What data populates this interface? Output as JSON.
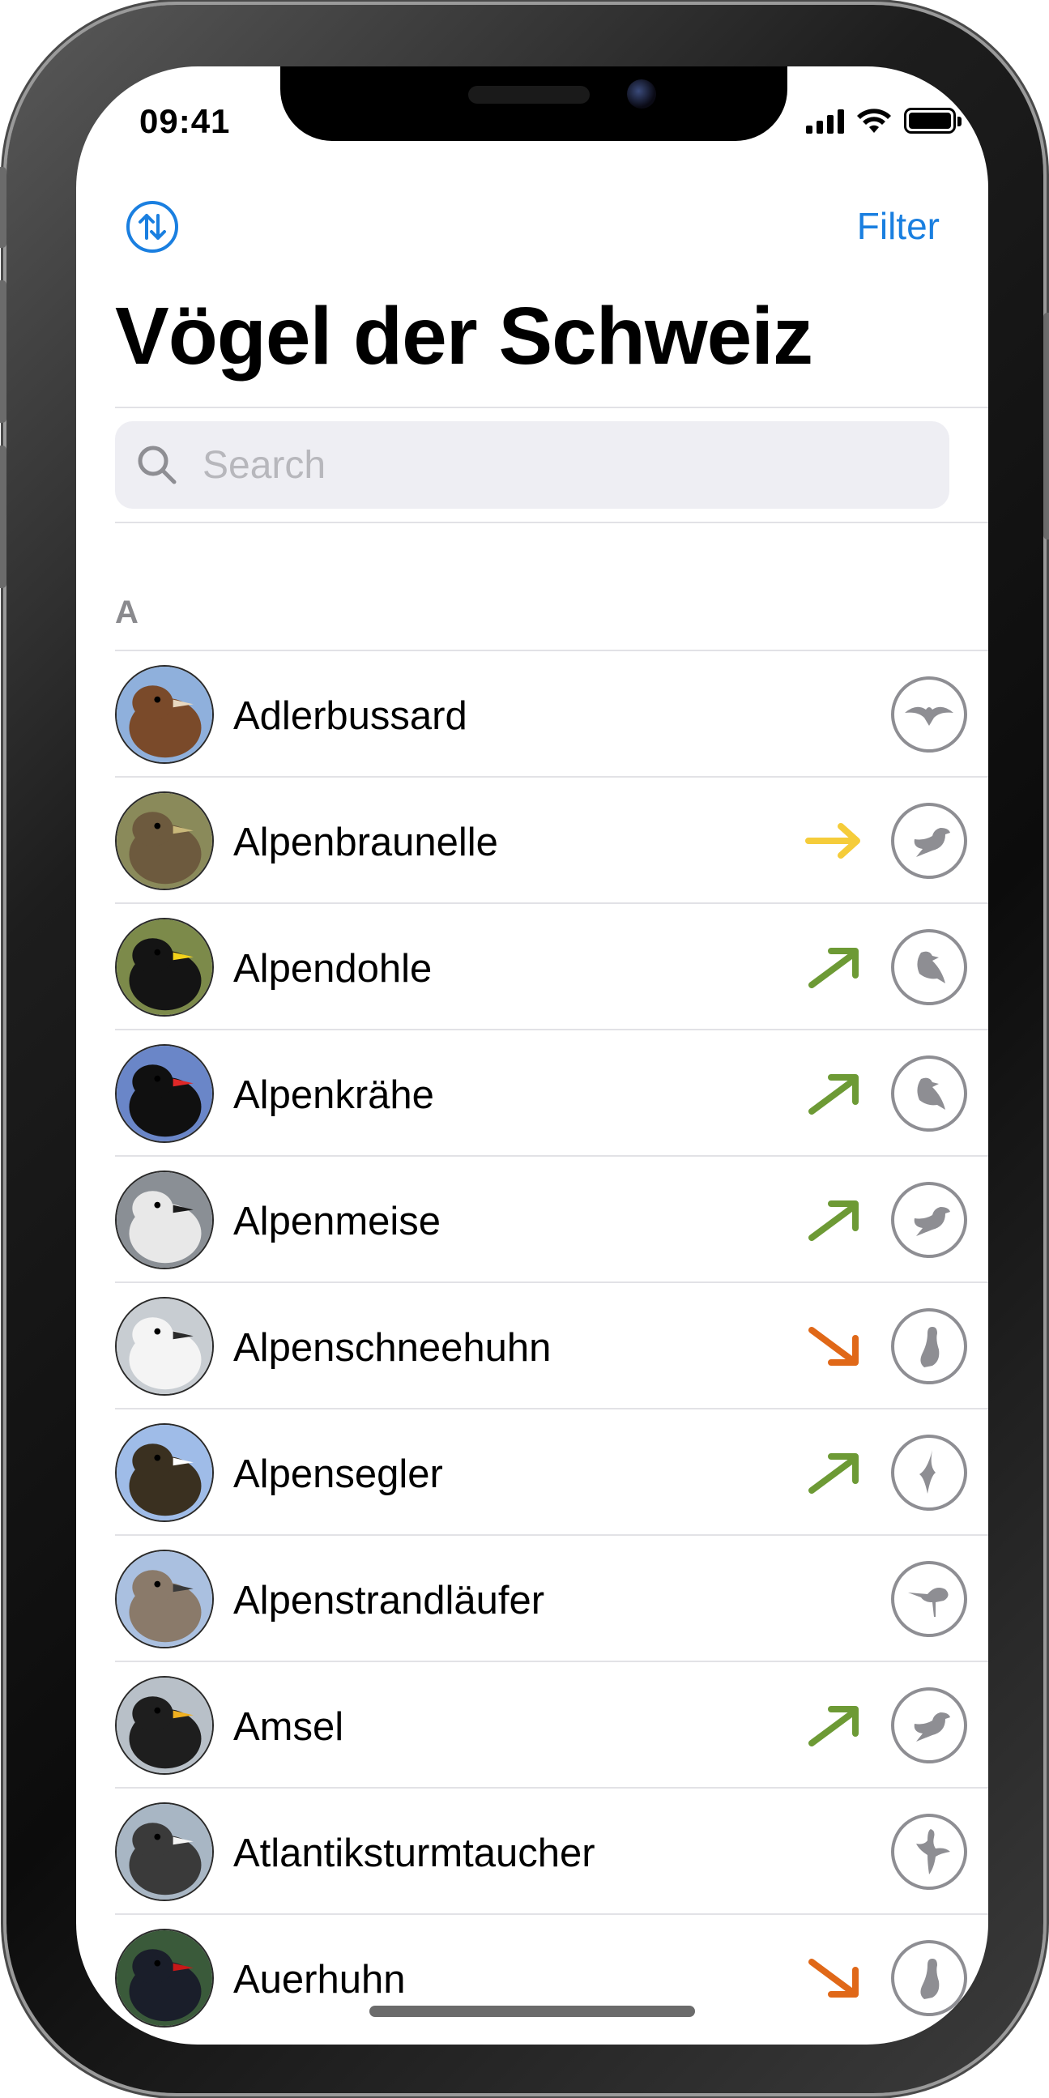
{
  "status_bar": {
    "time": "09:41"
  },
  "nav": {
    "title": "Vögel der Schweiz",
    "filter_label": "Filter",
    "sort_icon": "sort-arrows-icon"
  },
  "search": {
    "placeholder": "Search",
    "value": ""
  },
  "section": {
    "letter": "A"
  },
  "colors": {
    "accent": "#1a7fe0",
    "trend_flat": "#f5cc3a",
    "trend_up": "#6d9a35",
    "trend_down": "#e06818",
    "icon_gray": "#8e8e93"
  },
  "birds": [
    {
      "name": "Adlerbussard",
      "trend": "none",
      "type_icon": "raptor-icon"
    },
    {
      "name": "Alpenbraunelle",
      "trend": "flat",
      "type_icon": "songbird-icon"
    },
    {
      "name": "Alpendohle",
      "trend": "up",
      "type_icon": "crow-icon"
    },
    {
      "name": "Alpenkrähe",
      "trend": "up",
      "type_icon": "crow-icon"
    },
    {
      "name": "Alpenmeise",
      "trend": "up",
      "type_icon": "songbird-icon"
    },
    {
      "name": "Alpenschneehuhn",
      "trend": "down",
      "type_icon": "grouse-icon"
    },
    {
      "name": "Alpensegler",
      "trend": "up",
      "type_icon": "swift-icon"
    },
    {
      "name": "Alpenstrandläufer",
      "trend": "none",
      "type_icon": "wader-icon"
    },
    {
      "name": "Amsel",
      "trend": "up",
      "type_icon": "songbird-icon"
    },
    {
      "name": "Atlantiksturmtaucher",
      "trend": "none",
      "type_icon": "seabird-icon"
    },
    {
      "name": "Auerhuhn",
      "trend": "down",
      "type_icon": "grouse-icon"
    }
  ]
}
